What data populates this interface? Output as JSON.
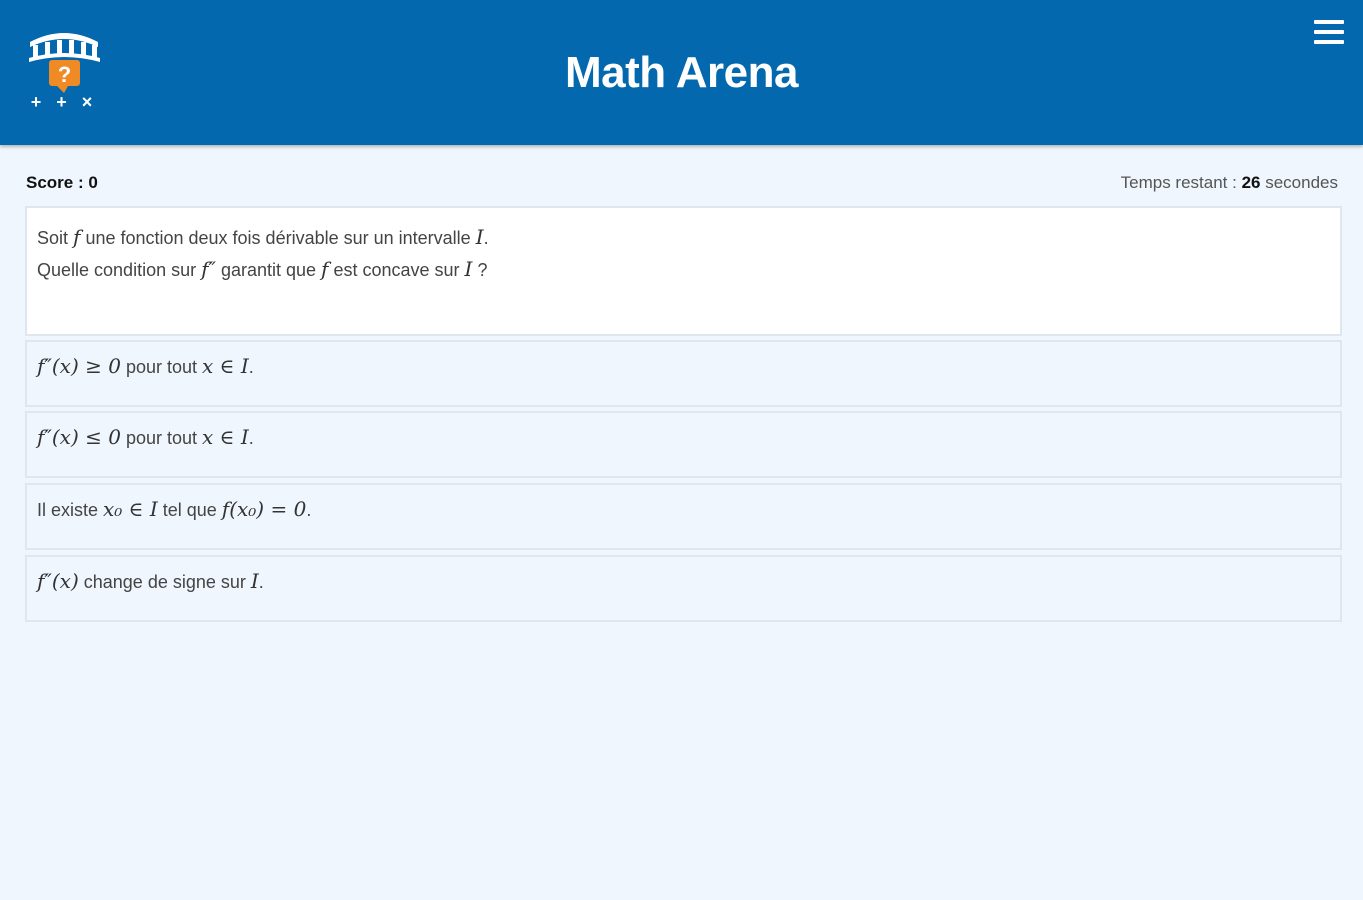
{
  "header": {
    "title": "Math Arena",
    "logo_marks": "+ + ×",
    "logo_question_mark": "?",
    "menu_icon": "hamburger-menu-icon"
  },
  "status": {
    "score_label": "Score : 0",
    "time_prefix": "Temps restant : ",
    "time_value": "26",
    "time_suffix": " secondes"
  },
  "question": {
    "line1_pre": "Soit ",
    "line1_f": "f",
    "line1_mid": " une fonction deux fois dérivable sur un intervalle ",
    "line1_I": "I",
    "line1_end": ".",
    "line2_pre": "Quelle condition sur ",
    "line2_f2": "f″",
    "line2_mid": " garantit que ",
    "line2_f": "f",
    "line2_mid2": " est concave sur ",
    "line2_I": "I",
    "line2_end": " ?"
  },
  "answers": [
    {
      "math1": "f″(x) ≥ 0",
      "text": " pour tout ",
      "math2": "x ∈ I",
      "end": "."
    },
    {
      "math1": "f″(x) ≤ 0",
      "text": " pour tout ",
      "math2": "x ∈ I",
      "end": "."
    },
    {
      "text1": "Il existe ",
      "math1": "x₀ ∈ I",
      "text2": " tel que ",
      "math2": "f(x₀) = 0",
      "end": "."
    },
    {
      "math1": "f″(x)",
      "text": " change de signe sur ",
      "math2": "I",
      "end": "."
    }
  ],
  "colors": {
    "header_bg": "#0368ae",
    "page_bg": "#eff6fd",
    "logo_orange": "#f08a24"
  }
}
